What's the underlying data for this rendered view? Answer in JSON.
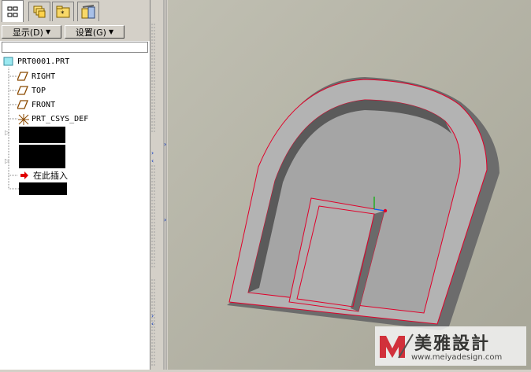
{
  "tabs": [
    {
      "name": "model-tree-tab",
      "icon": "tree-icon"
    },
    {
      "name": "layers-tab",
      "icon": "layers-icon"
    },
    {
      "name": "folder-tab",
      "icon": "folder-browser-icon"
    },
    {
      "name": "favorites-tab",
      "icon": "favorites-icon"
    }
  ],
  "toolbar": {
    "show_label": "显示(D)",
    "settings_label": "设置(G)"
  },
  "tree": {
    "root": "PRT0001.PRT",
    "items": [
      {
        "label": "RIGHT",
        "icon": "datum-plane-icon"
      },
      {
        "label": "TOP",
        "icon": "datum-plane-icon"
      },
      {
        "label": "FRONT",
        "icon": "datum-plane-icon"
      },
      {
        "label": "PRT_CSYS_DEF",
        "icon": "coordinate-system-icon"
      }
    ],
    "insert_here": "在此插入"
  },
  "watermark": {
    "brand": "美雅設計",
    "url": "www.meiyadesign.com"
  },
  "colors": {
    "panel": "#d4d0c8",
    "viewport_bg": "#b8b7a7",
    "edge_highlight": "#e0002a",
    "model_face": "#b2b2b2"
  }
}
